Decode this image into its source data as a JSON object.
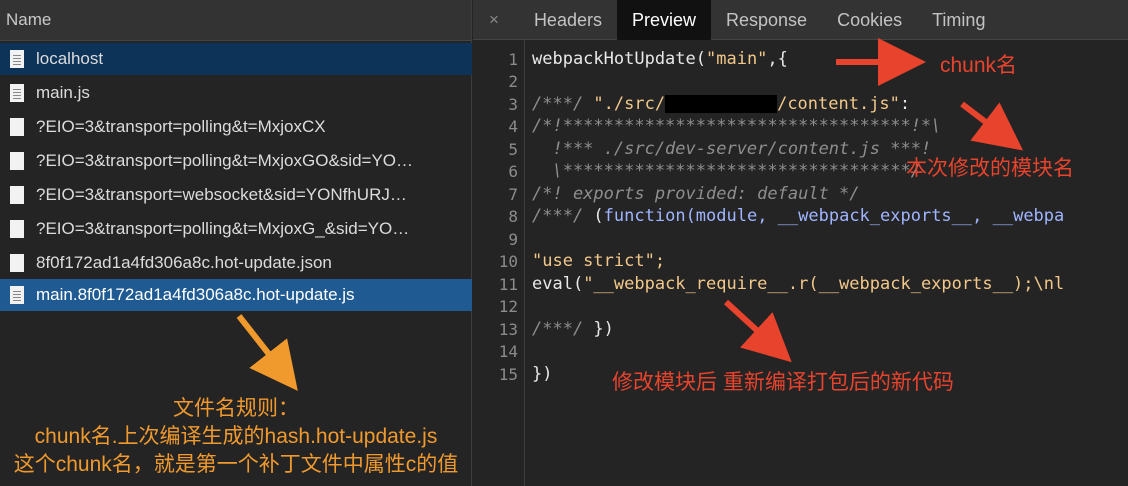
{
  "left_panel": {
    "header": "Name",
    "requests": [
      {
        "name": "localhost"
      },
      {
        "name": "main.js"
      },
      {
        "name": "?EIO=3&transport=polling&t=MxjoxCX"
      },
      {
        "name": "?EIO=3&transport=polling&t=MxjoxGO&sid=YO…"
      },
      {
        "name": "?EIO=3&transport=websocket&sid=YONfhURJ…"
      },
      {
        "name": "?EIO=3&transport=polling&t=MxjoxG_&sid=YO…"
      },
      {
        "name": "8f0f172ad1a4fd306a8c.hot-update.json"
      },
      {
        "name": "main.8f0f172ad1a4fd306a8c.hot-update.js"
      }
    ],
    "annotation": {
      "line1": "文件名规则：",
      "line2": "chunk名.上次编译生成的hash.hot-update.js",
      "line3": "这个chunk名，就是第一个补丁文件中属性c的值"
    }
  },
  "tabs": {
    "close": "×",
    "items": [
      "Headers",
      "Preview",
      "Response",
      "Cookies",
      "Timing"
    ],
    "active": "Preview"
  },
  "code": {
    "line_numbers": [
      "1",
      "2",
      "3",
      "4",
      "5",
      "6",
      "7",
      "8",
      "9",
      "10",
      "11",
      "12",
      "13",
      "14",
      "15"
    ],
    "l1a": "webpackHotUpdate(",
    "l1b": "\"main\"",
    "l1c": ",{",
    "l3a": "/***/ ",
    "l3b": "\"./src/",
    "l3c": "/content.js\"",
    "l3d": ":",
    "l4": "/*!**********************************!*\\",
    "l5": "  !*** ./src/dev-server/content.js ***!",
    "l6": "  \\**********************************/",
    "l7": "/*! exports provided: default */",
    "l8a": "/***/ ",
    "l8b": "(",
    "l8c": "function",
    "l8d": "(module, __webpack_exports__, __webpa",
    "l10": "\"use strict\";",
    "l11a": "eval(",
    "l11b": "\"__webpack_require__.r(__webpack_exports__);\\nl",
    "l13a": "/***/ ",
    "l13b": "})",
    "l15": "})"
  },
  "annotations": {
    "chunk_name": "chunk名",
    "module_name": "本次修改的模块名",
    "recompile": "修改模块后 重新编译打包后的新代码"
  },
  "colors": {
    "annotation_red": "#e8432d",
    "annotation_orange": "#f09a2e",
    "selected_row": "#1f5a92"
  }
}
